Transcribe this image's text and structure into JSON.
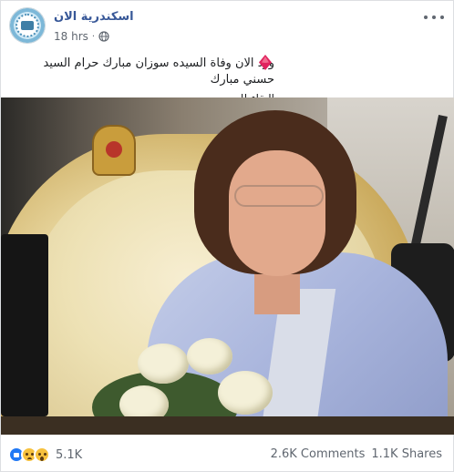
{
  "post": {
    "page_name": "اسكندرية الان",
    "time": "18 hrs",
    "separator": "·",
    "privacy_icon": "globe-icon",
    "menu_icon": "more-options-icon",
    "text_line1": "ورد الان وفاة السيده سوزان مبارك حرام السيد حسني مبارك",
    "text_line2": "البقاء لله",
    "emoji": "red-diamond-icon"
  },
  "footer": {
    "reaction_icons": [
      "like-icon",
      "sad-icon",
      "wow-icon"
    ],
    "reaction_count": "5.1K",
    "comments": "2.6K Comments",
    "shares": "1.1K Shares"
  },
  "colors": {
    "page_name": "#385898",
    "meta": "#606770",
    "like": "#2078f4",
    "emoji_yellow": "#f7c13d",
    "diamond": "#e0245e"
  }
}
